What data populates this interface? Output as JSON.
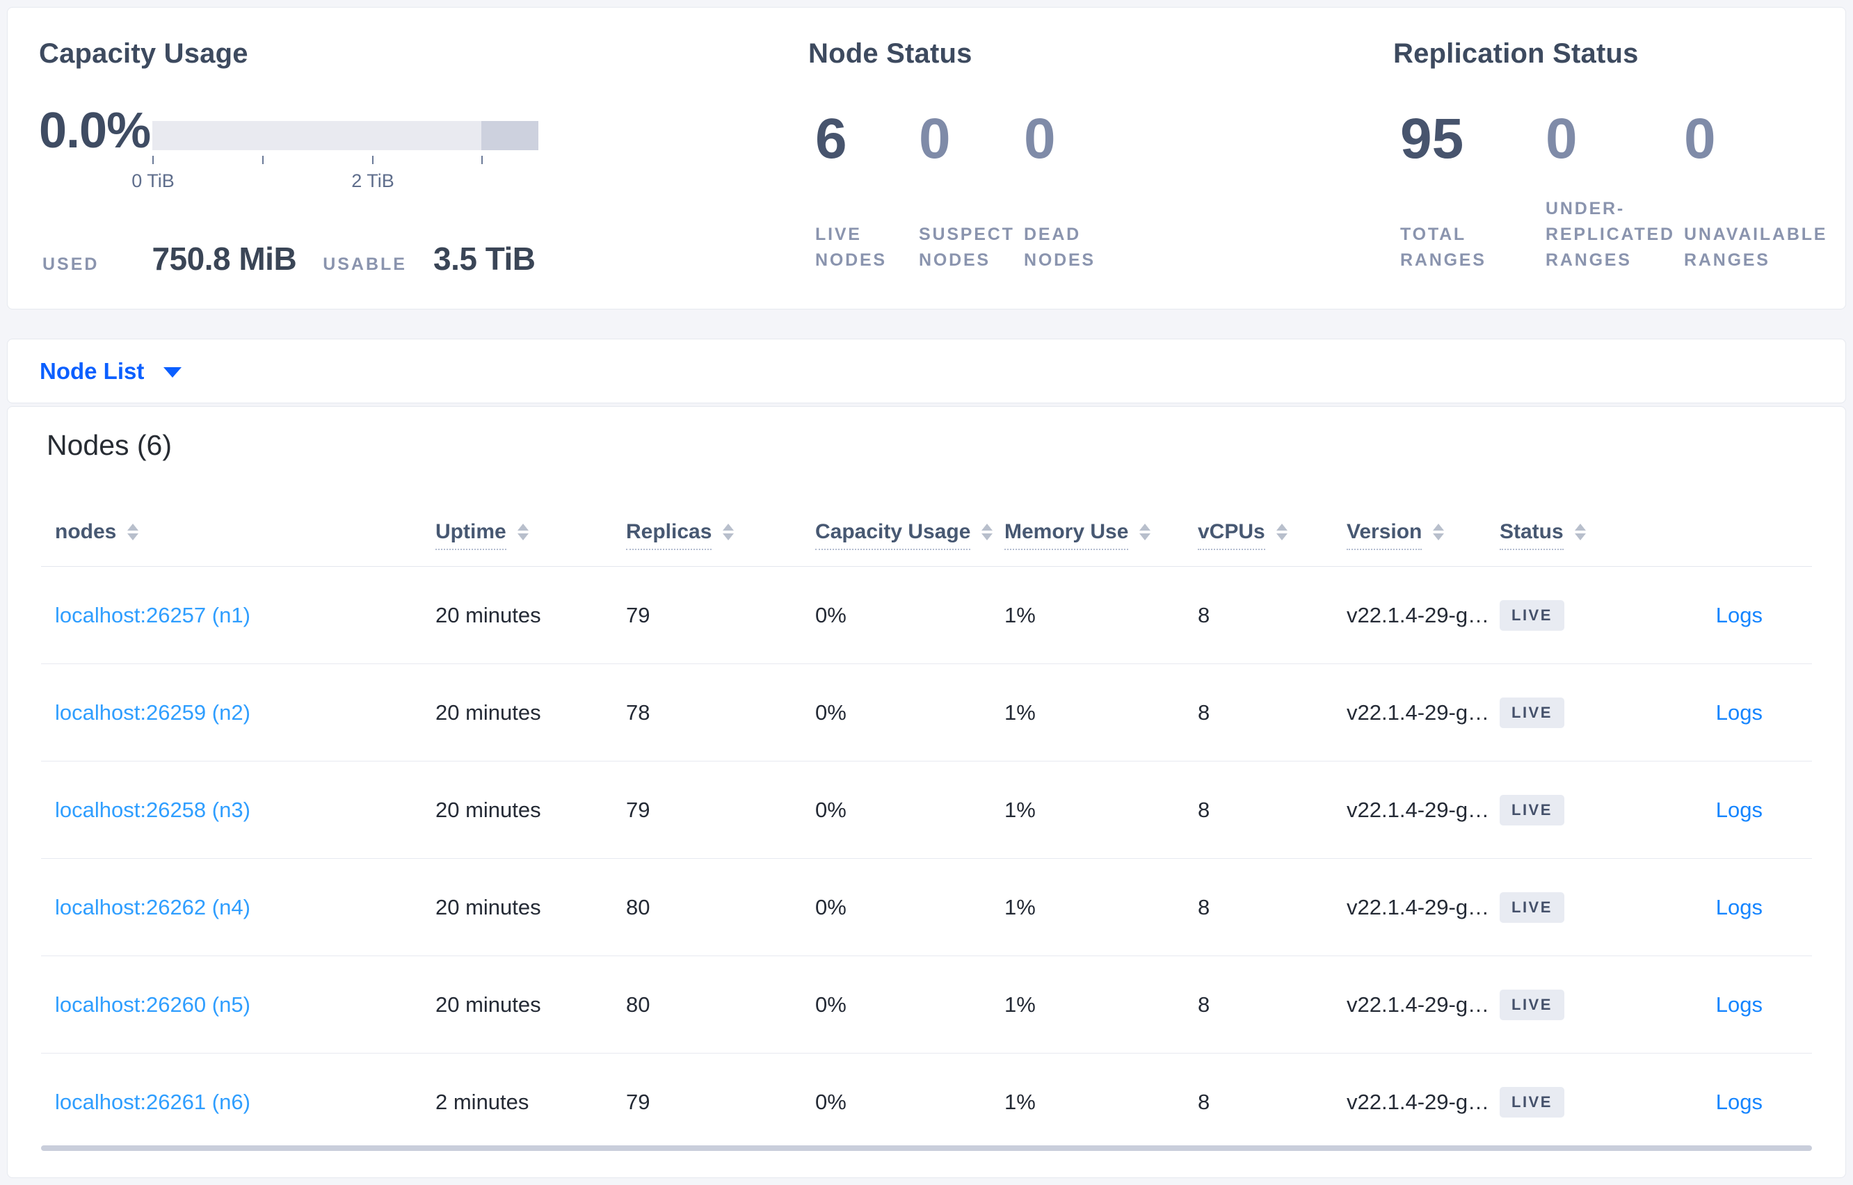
{
  "summary": {
    "capacity": {
      "title": "Capacity Usage",
      "percent": "0.0%",
      "tick_labels": [
        "0 TiB",
        "2 TiB"
      ],
      "axis_ticks_tib": [
        0,
        1,
        2,
        3
      ],
      "used_label": "USED",
      "used_value": "750.8 MiB",
      "usable_label": "USABLE",
      "usable_value": "3.5 TiB"
    },
    "node_status": {
      "title": "Node Status",
      "stats": [
        {
          "value": "6",
          "label": "LIVE\nNODES"
        },
        {
          "value": "0",
          "label": "SUSPECT\nNODES"
        },
        {
          "value": "0",
          "label": "DEAD\nNODES"
        }
      ]
    },
    "replication": {
      "title": "Replication Status",
      "stats": [
        {
          "value": "95",
          "label": "TOTAL\nRANGES"
        },
        {
          "value": "0",
          "label": "UNDER-\nREPLICATED\nRANGES"
        },
        {
          "value": "0",
          "label": "UNAVAILABLE\nRANGES"
        }
      ]
    }
  },
  "node_list": {
    "label": "Node List"
  },
  "nodes_table": {
    "title": "Nodes (6)",
    "columns": [
      "nodes",
      "Uptime",
      "Replicas",
      "Capacity Usage",
      "Memory Use",
      "vCPUs",
      "Version",
      "Status"
    ],
    "rows": [
      {
        "node": "localhost:26257 (n1)",
        "uptime": "20 minutes",
        "replicas": "79",
        "capacity": "0%",
        "memory": "1%",
        "vcpus": "8",
        "version": "v22.1.4-29-g…",
        "status": "LIVE",
        "logs": "Logs"
      },
      {
        "node": "localhost:26259 (n2)",
        "uptime": "20 minutes",
        "replicas": "78",
        "capacity": "0%",
        "memory": "1%",
        "vcpus": "8",
        "version": "v22.1.4-29-g…",
        "status": "LIVE",
        "logs": "Logs"
      },
      {
        "node": "localhost:26258 (n3)",
        "uptime": "20 minutes",
        "replicas": "79",
        "capacity": "0%",
        "memory": "1%",
        "vcpus": "8",
        "version": "v22.1.4-29-g…",
        "status": "LIVE",
        "logs": "Logs"
      },
      {
        "node": "localhost:26262 (n4)",
        "uptime": "20 minutes",
        "replicas": "80",
        "capacity": "0%",
        "memory": "1%",
        "vcpus": "8",
        "version": "v22.1.4-29-g…",
        "status": "LIVE",
        "logs": "Logs"
      },
      {
        "node": "localhost:26260 (n5)",
        "uptime": "20 minutes",
        "replicas": "80",
        "capacity": "0%",
        "memory": "1%",
        "vcpus": "8",
        "version": "v22.1.4-29-g…",
        "status": "LIVE",
        "logs": "Logs"
      },
      {
        "node": "localhost:26261 (n6)",
        "uptime": "2 minutes",
        "replicas": "79",
        "capacity": "0%",
        "memory": "1%",
        "vcpus": "8",
        "version": "v22.1.4-29-g…",
        "status": "LIVE",
        "logs": "Logs"
      }
    ]
  },
  "colors": {
    "accent_blue": "#0b5fff",
    "node_link_blue": "#2f9eff",
    "logs_link_blue": "#1585ff",
    "badge_bg": "#e8ebf2",
    "badge_text": "#44506a",
    "bar_light": "#e9eaf0",
    "bar_dark": "#cdd1de",
    "page_bg": "#f4f5f9"
  }
}
